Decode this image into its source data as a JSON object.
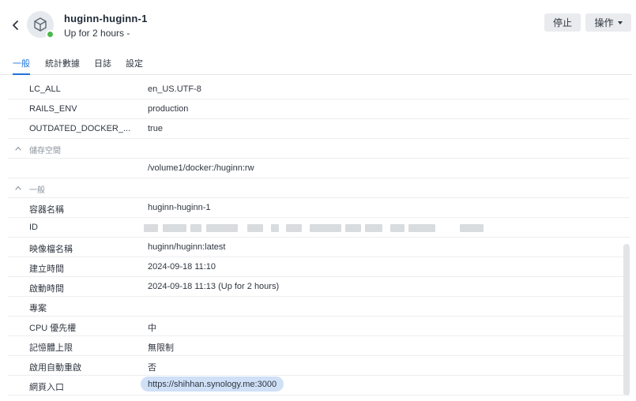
{
  "header": {
    "title": "huginn-huginn-1",
    "subtitle": "Up for 2 hours -",
    "stop_label": "停止",
    "action_label": "操作",
    "status_color": "#4cb84c"
  },
  "tabs": [
    {
      "label": "一般",
      "active": true
    },
    {
      "label": "統計數據",
      "active": false
    },
    {
      "label": "日誌",
      "active": false
    },
    {
      "label": "設定",
      "active": false
    }
  ],
  "env_rows": [
    {
      "key": "LC_ALL",
      "value": "en_US.UTF-8"
    },
    {
      "key": "RAILS_ENV",
      "value": "production"
    },
    {
      "key": "OUTDATED_DOCKER_...",
      "value": "true"
    }
  ],
  "storage": {
    "section_label": "儲存空間",
    "rows": [
      {
        "key": "",
        "value": "/volume1/docker:/huginn:rw"
      }
    ]
  },
  "general": {
    "section_label": "一般",
    "rows": [
      {
        "key": "容器名稱",
        "value": "huginn-huginn-1"
      },
      {
        "key": "ID",
        "value": ""
      },
      {
        "key": "映像檔名稱",
        "value": "huginn/huginn:latest"
      },
      {
        "key": "建立時間",
        "value": "2024-09-18 11:10"
      },
      {
        "key": "啟動時間",
        "value": "2024-09-18 11:13 (Up for 2 hours)"
      },
      {
        "key": "專案",
        "value": ""
      },
      {
        "key": "CPU 優先權",
        "value": "中"
      },
      {
        "key": "記憶體上限",
        "value": "無限制"
      },
      {
        "key": "啟用自動重啟",
        "value": "否"
      },
      {
        "key": "網頁入口",
        "value": "https://shihhan.synology.me:3000"
      }
    ]
  },
  "colors": {
    "accent": "#1f73d8",
    "link_chip": "#cfe0f7"
  }
}
